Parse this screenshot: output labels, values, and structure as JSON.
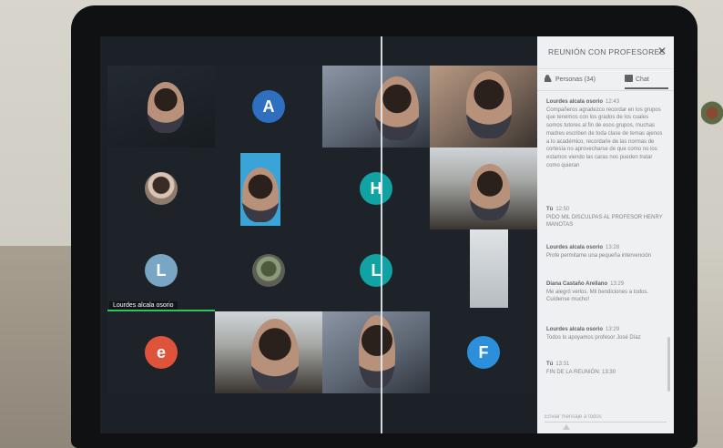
{
  "panel": {
    "title": "REUNIÓN CON PROFESORES",
    "close_label": "✕",
    "tabs": {
      "people": "Personas (34)",
      "chat": "Chat"
    },
    "compose_placeholder": "Enviar mensaje a todos"
  },
  "messages": [
    {
      "sender": "Lourdes alcala osorio",
      "time": "12:43",
      "text": "Compañeros agradezco recordar en los grupos que tenemos con los grados de los cuales somos tutores al fin de esos grupos, muchas madres escriben de toda clase de temas ajenos a lo académico, recordarle de las normas de cortesía no aprovecharse de que como no los estamos viendo las caras nos pueden tratar como quieran"
    },
    {
      "sender": "Tú",
      "time": "12:50",
      "text": "PIDO MIL DISCULPAS AL PROFESOR HENRY MANOTAS"
    },
    {
      "sender": "Lourdes alcala osorio",
      "time": "13:28",
      "text": "Profe permitame una pequeña intervención"
    },
    {
      "sender": "Diana Castaño Arellano",
      "time": "13:29",
      "text": "Me alegró verlos. Mil bendiciones a todos. Cuídense mucho!"
    },
    {
      "sender": "Lourdes alcala osorio",
      "time": "13:29",
      "text": "Todos lo apoyamos profesor José Díaz"
    },
    {
      "sender": "Tú",
      "time": "13:31",
      "text": "FIN DE LA REUNIÓN: 13:30"
    }
  ],
  "participants": [
    {
      "kind": "camera",
      "label": ""
    },
    {
      "kind": "letter",
      "letter": "A",
      "color": "#2f6fc0"
    },
    {
      "kind": "camera",
      "label": ""
    },
    {
      "kind": "camera",
      "label": ""
    },
    {
      "kind": "photo",
      "label": ""
    },
    {
      "kind": "camera",
      "label": ""
    },
    {
      "kind": "letter",
      "letter": "H",
      "color": "#11a3a3"
    },
    {
      "kind": "camera",
      "label": ""
    },
    {
      "kind": "letter",
      "letter": "L",
      "color": "#7aa6c6"
    },
    {
      "kind": "photo",
      "label": ""
    },
    {
      "kind": "letter",
      "letter": "L",
      "color": "#11a3a3"
    },
    {
      "kind": "camera",
      "label": ""
    },
    {
      "kind": "letter",
      "letter": "e",
      "color": "#e0533b"
    },
    {
      "kind": "camera",
      "label": ""
    },
    {
      "kind": "camera",
      "label": ""
    },
    {
      "kind": "letter",
      "letter": "F",
      "color": "#2c8fdc"
    }
  ],
  "active_speaker_name": "Lourdes alcala osorio"
}
